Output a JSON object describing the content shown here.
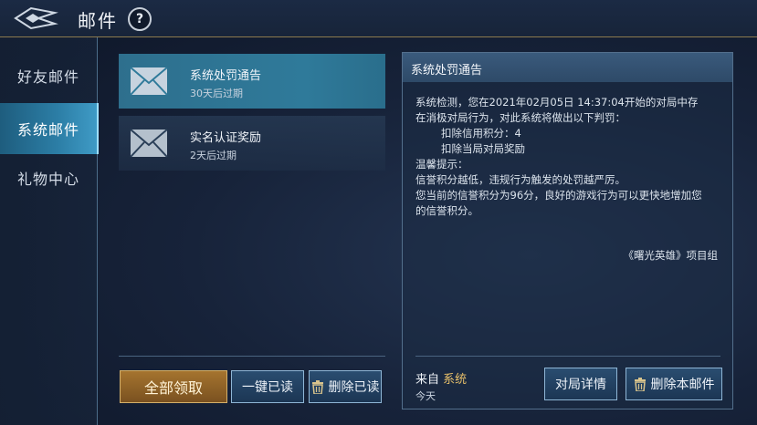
{
  "header": {
    "title": "邮件",
    "help_label": "?"
  },
  "sidebar": {
    "tabs": [
      {
        "label": "好友邮件",
        "active": false
      },
      {
        "label": "系统邮件",
        "active": true
      },
      {
        "label": "礼物中心",
        "active": false
      }
    ]
  },
  "mail_list": [
    {
      "title": "系统处罚通告",
      "expiry": "30天后过期",
      "selected": true
    },
    {
      "title": "实名认证奖励",
      "expiry": "2天后过期",
      "selected": false
    }
  ],
  "actions": {
    "claim_all": "全部领取",
    "mark_all_read": "一键已读",
    "delete_read": "删除已读"
  },
  "detail": {
    "title": "系统处罚通告",
    "body_lines": [
      "系统检测，您在2021年02月05日 14:37:04开始的对局中存",
      "在消极对局行为，对此系统将做出以下判罚：",
      "扣除信用积分：4",
      "扣除当局对局奖励",
      "温馨提示：",
      "信誉积分越低，违规行为触发的处罚越严厉。",
      "您当前的信誉积分为96分，良好的游戏行为可以更快地增加您",
      "的信誉积分。"
    ],
    "signature": "《曙光英雄》项目组",
    "from_prefix": "来自",
    "from_sender": "系统",
    "date": "今天",
    "match_details_button": "对局详情",
    "delete_button": "删除本邮件"
  },
  "colors": {
    "accent": "#2f7a9a",
    "gold": "#e8c06a",
    "border": "#536f8c"
  }
}
